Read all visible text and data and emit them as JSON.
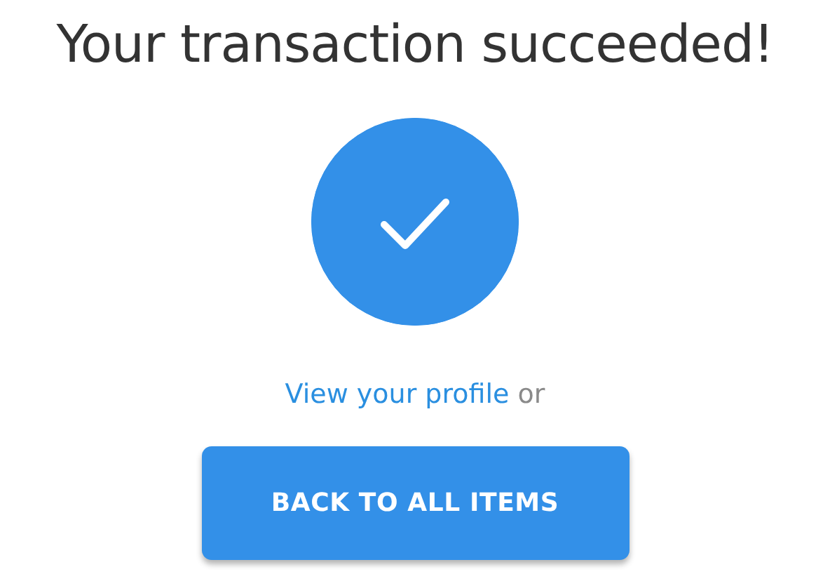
{
  "title": "Your transaction succeeded!",
  "profile_link": "View your profile",
  "connector": "or",
  "button": "BACK TO ALL ITEMS"
}
